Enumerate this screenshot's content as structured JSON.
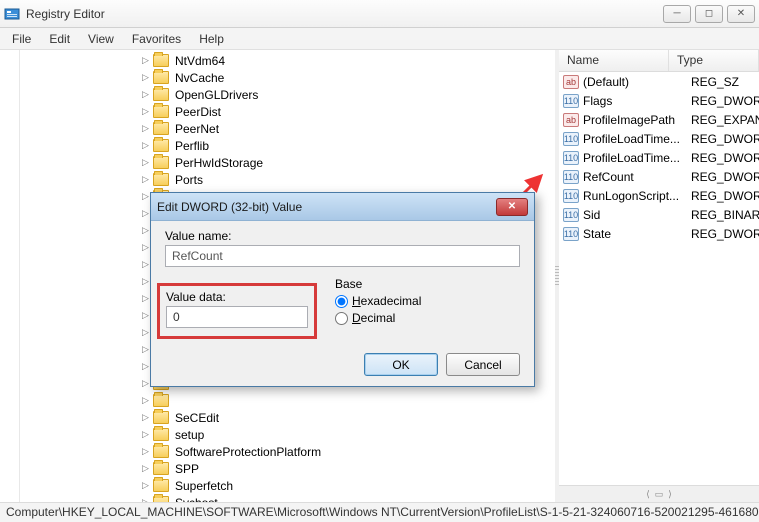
{
  "window": {
    "title": "Registry Editor"
  },
  "menu": {
    "file": "File",
    "edit": "Edit",
    "view": "View",
    "favorites": "Favorites",
    "help": "Help"
  },
  "tree": {
    "items": [
      "NtVdm64",
      "NvCache",
      "OpenGLDrivers",
      "PeerDist",
      "PeerNet",
      "Perflib",
      "PerHwIdStorage",
      "Ports",
      "",
      "",
      "",
      "",
      "",
      "",
      "",
      "",
      "",
      "",
      "",
      "",
      "",
      "SeCEdit",
      "setup",
      "SoftwareProtectionPlatform",
      "SPP",
      "Superfetch",
      "Svchost"
    ]
  },
  "list": {
    "header": {
      "name": "Name",
      "type": "Type"
    },
    "rows": [
      {
        "icon": "str",
        "name": "(Default)",
        "type": "REG_SZ"
      },
      {
        "icon": "bin",
        "name": "Flags",
        "type": "REG_DWORD"
      },
      {
        "icon": "str",
        "name": "ProfileImagePath",
        "type": "REG_EXPAND_S"
      },
      {
        "icon": "bin",
        "name": "ProfileLoadTime...",
        "type": "REG_DWORD"
      },
      {
        "icon": "bin",
        "name": "ProfileLoadTime...",
        "type": "REG_DWORD"
      },
      {
        "icon": "bin",
        "name": "RefCount",
        "type": "REG_DWORD"
      },
      {
        "icon": "bin",
        "name": "RunLogonScript...",
        "type": "REG_DWORD"
      },
      {
        "icon": "bin",
        "name": "Sid",
        "type": "REG_BINARY"
      },
      {
        "icon": "bin",
        "name": "State",
        "type": "REG_DWORD"
      }
    ]
  },
  "dialog": {
    "title": "Edit DWORD (32-bit) Value",
    "value_name_label": "Value name:",
    "value_name": "RefCount",
    "value_data_label": "Value data:",
    "value_data": "0",
    "base_label": "Base",
    "hex_label": "Hexadecimal",
    "dec_label": "Decimal",
    "ok": "OK",
    "cancel": "Cancel"
  },
  "status": {
    "path": "Computer\\HKEY_LOCAL_MACHINE\\SOFTWARE\\Microsoft\\Windows NT\\CurrentVersion\\ProfileList\\S-1-5-21-324060716-520021295-461680"
  }
}
